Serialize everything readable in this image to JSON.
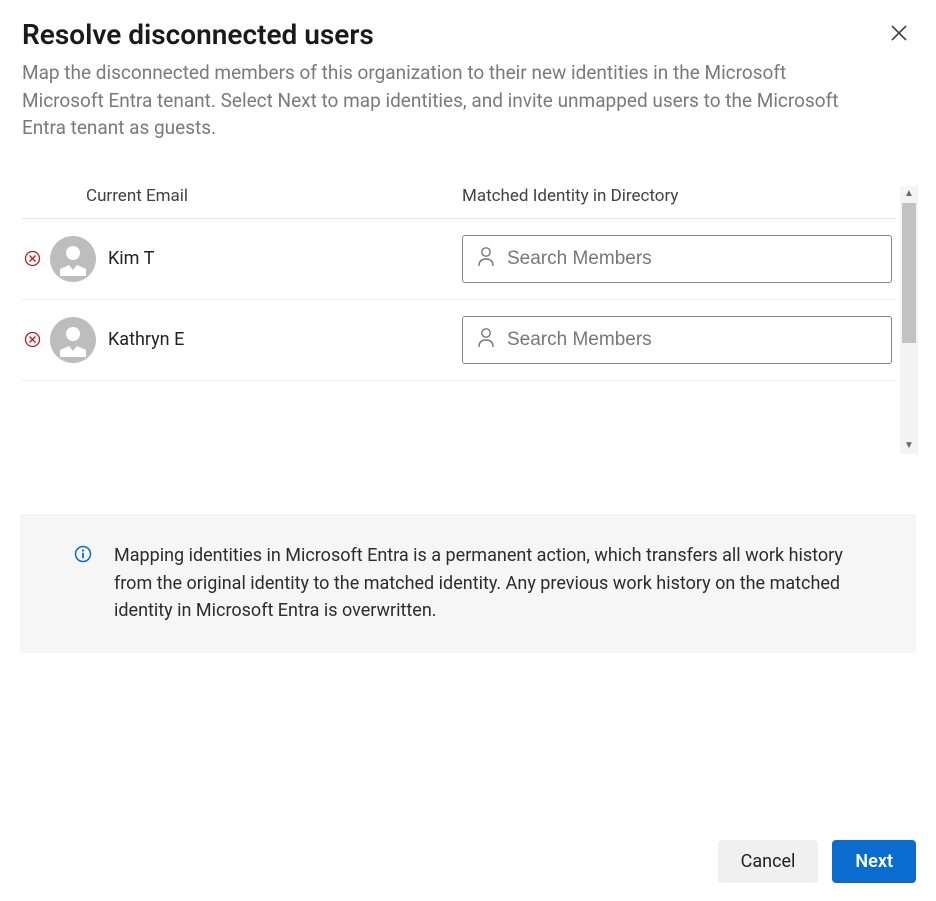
{
  "header": {
    "title": "Resolve disconnected users",
    "subtitle": "Map the disconnected members of this organization to their new identities in the Microsoft Microsoft Entra tenant. Select Next to map identities, and invite unmapped users to the Microsoft Entra tenant as guests."
  },
  "columns": {
    "current_email": "Current Email",
    "matched_identity": "Matched Identity in Directory"
  },
  "users": [
    {
      "name": "Kim T",
      "search_placeholder": "Search Members"
    },
    {
      "name": "Kathryn E",
      "search_placeholder": "Search Members"
    }
  ],
  "info": {
    "text": "Mapping identities in Microsoft Entra is a permanent action, which transfers all work history from the original identity to the matched identity. Any previous work history on the matched identity in Microsoft Entra is overwritten."
  },
  "footer": {
    "cancel": "Cancel",
    "next": "Next"
  }
}
